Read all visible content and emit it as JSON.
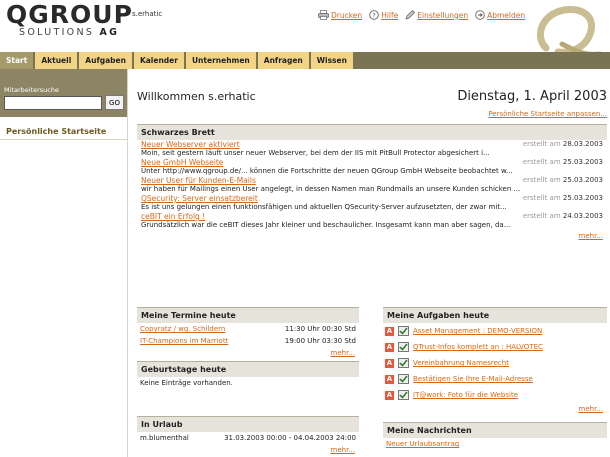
{
  "header": {
    "logo_main": "QGROUP",
    "logo_sub": "SOLUTIONS",
    "logo_ag": "AG",
    "username": "s.erhatic",
    "links": [
      {
        "label": "Drucken",
        "icon": "printer-icon"
      },
      {
        "label": "Hilfe",
        "icon": "help-icon"
      },
      {
        "label": "Einstellungen",
        "icon": "pen-icon"
      },
      {
        "label": "Abmelden",
        "icon": "logout-icon"
      }
    ]
  },
  "nav": {
    "tabs": [
      {
        "label": "Start",
        "active": true
      },
      {
        "label": "Aktuell"
      },
      {
        "label": "Aufgaben"
      },
      {
        "label": "Kalender"
      },
      {
        "label": "Unternehmen"
      },
      {
        "label": "Anfragen"
      },
      {
        "label": "Wissen"
      }
    ]
  },
  "sidebar": {
    "search_label": "Mitarbeitersuche",
    "search_value": "",
    "go_label": "GO",
    "start_link": "Persönliche Startseite"
  },
  "main": {
    "welcome": "Willkommen s.erhatic",
    "date": "Dienstag, 1. April 2003",
    "customize_link": "Persönliche Startseite anpassen..."
  },
  "board": {
    "title": "Schwarzes Brett",
    "created_label": "erstellt am",
    "items": [
      {
        "title": "Neuer Webserver aktiviert",
        "date": "28.03.2003",
        "text": "Moin, seit gestern läuft unser neuer Webserver, bei dem der IIS mit PitBull Protector abgesichert i..."
      },
      {
        "title": "Neue GmbH Webseite",
        "date": "25.03.2003",
        "text": "Unter http://www.qgroup.de/... können die Fortschritte der neuen QGroup GmbH Webseite beobachtet w..."
      },
      {
        "title": "Neuer User für Kunden-E-Mails",
        "date": "25.03.2003",
        "text": "wir haben für Mailings einen User angelegt, in dessen Namen man Rundmails an unsere Kunden schicken ..."
      },
      {
        "title": "QSecurity: Server einsatzbereit",
        "date": "25.03.2003",
        "text": "Es ist uns gelungen einen funktionsfähigen und aktuellen QSecurity-Server aufzusetzten, der zwar mit..."
      },
      {
        "title": "ceBIT ein Erfolg !",
        "date": "24.03.2003",
        "text": "Grundsätzlich war die ceBIT dieses Jahr kleiner und beschaulicher. Insgesamt kann man aber sagen, da..."
      }
    ],
    "more": "mehr..."
  },
  "termine": {
    "title": "Meine Termine heute",
    "items": [
      {
        "name": "Copyratz / wg. Schildern",
        "time": "11:30 Uhr 00:30 Std"
      },
      {
        "name": "IT-Champions im Marriott",
        "time": "19:00 Uhr 03:30 Std"
      }
    ],
    "more": "mehr..."
  },
  "geburtstage": {
    "title": "Geburtstage heute",
    "text": "Keine Einträge vorhanden."
  },
  "urlaub": {
    "title": "In Urlaub",
    "items": [
      {
        "name": "m.blumenthal",
        "range": "31.03.2003 00:00 - 04.04.2003 24:00"
      }
    ],
    "more": "mehr..."
  },
  "aufgaben": {
    "title": "Meine Aufgaben heute",
    "prio_label": "A",
    "items": [
      {
        "label": "Asset Management : DEMO-VERSION"
      },
      {
        "label": "QTrust-Infos komplett an : HALVOTEC"
      },
      {
        "label": "Vereinbahrung Namesrecht"
      },
      {
        "label": "Bestätigen Sie Ihre E-Mail-Adresse"
      },
      {
        "label": "IT@work: Foto für die Website"
      }
    ],
    "more": "mehr..."
  },
  "nachrichten": {
    "title": "Meine Nachrichten",
    "items": [
      {
        "label": "Neuer Urlaubsantrag"
      }
    ]
  },
  "colors": {
    "accent": "#d2691e",
    "nav_bar": "#7a7354",
    "tab_bg": "#f1d486",
    "tab_active": "#a49a6c",
    "prio": "#e4593b"
  }
}
